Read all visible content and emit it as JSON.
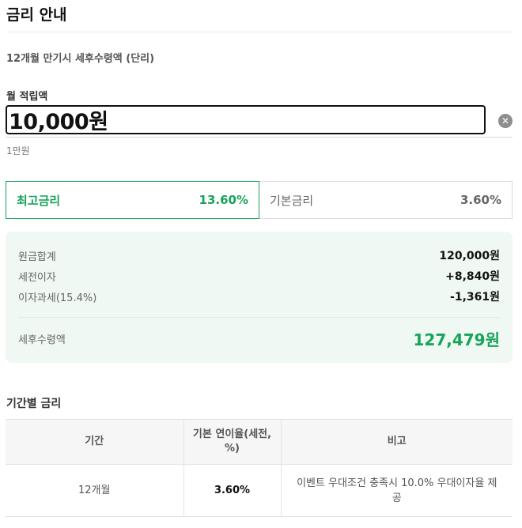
{
  "header": {
    "title": "금리 안내"
  },
  "subtitle": "12개월 만기시 세후수령액 (단리)",
  "deposit": {
    "label": "월 적립액",
    "value": "10,000원",
    "clear_icon": "close-circle-icon",
    "unit_hint": "1만원"
  },
  "rate_tabs": [
    {
      "name": "최고금리",
      "value": "13.60%",
      "active": true
    },
    {
      "name": "기본금리",
      "value": "3.60%",
      "active": false
    }
  ],
  "summary": {
    "rows": [
      {
        "label": "원금합계",
        "value": "120,000원"
      },
      {
        "label": "세전이자",
        "value": "+8,840원"
      },
      {
        "label": "이자과세(15.4%)",
        "value": "-1,361원"
      }
    ],
    "total_label": "세후수령액",
    "total_value": "127,479원"
  },
  "period_rates": {
    "title": "기간별 금리",
    "headers": [
      "기간",
      "기본 연이율(세전, %)",
      "비고"
    ],
    "rows": [
      {
        "period": "12개월",
        "rate": "3.60%",
        "note": "이벤트 우대조건 충족시 10.0% 우대이자율 제공"
      }
    ]
  },
  "colors": {
    "accent": "#18a35a",
    "summary_bg": "#eff8f2"
  }
}
